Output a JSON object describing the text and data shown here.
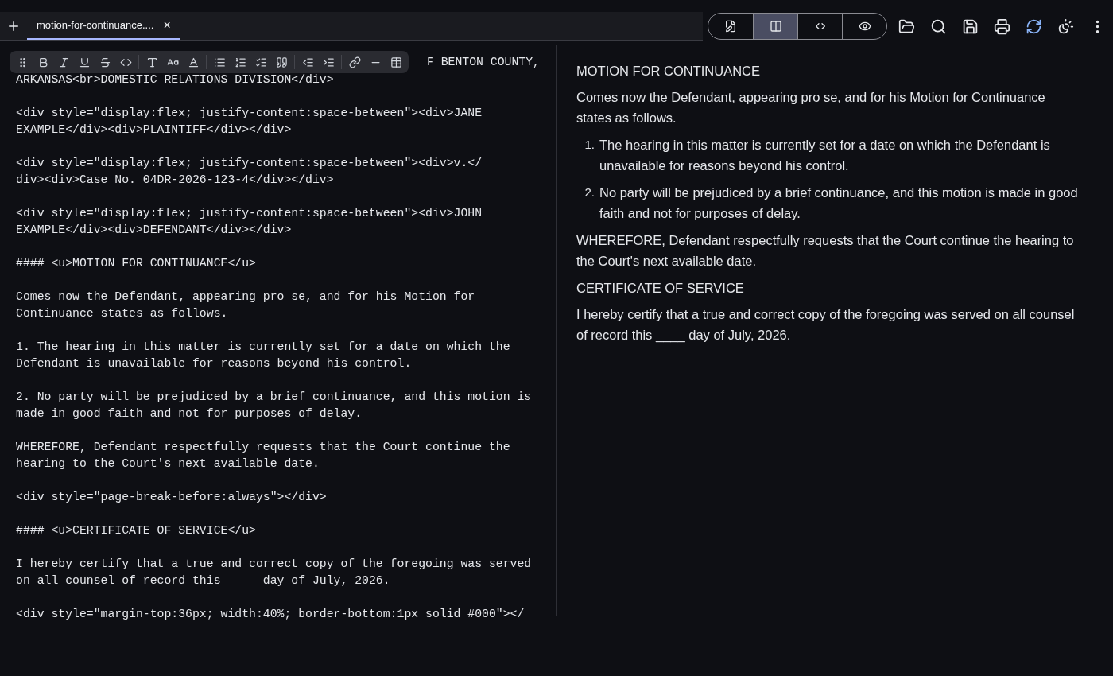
{
  "tabs": [
    {
      "label": "motion-for-continuance....",
      "selected": true,
      "close": "×"
    }
  ],
  "view_modes": [
    {
      "kind": "edit",
      "selected": false
    },
    {
      "kind": "split",
      "selected": true
    },
    {
      "kind": "source",
      "selected": false
    },
    {
      "kind": "preview",
      "selected": false
    }
  ],
  "editor": {
    "first_line_visible": "F BENTON COUNTY,",
    "blocks": [
      [
        "ARKANSAS<br>DOMESTIC RELATIONS DIVISION</div>"
      ],
      [
        "<div style=\"display:flex; justify-content:space-between\"><div>JANE",
        "EXAMPLE</div><div>PLAINTIFF</div></div>"
      ],
      [
        "<div style=\"display:flex; justify-content:space-between\"><div>v.</",
        "div><div>Case No. 04DR-2026-123-4</div></div>"
      ],
      [
        "<div style=\"display:flex; justify-content:space-between\"><div>JOHN",
        "EXAMPLE</div><div>DEFENDANT</div></div>"
      ],
      [
        "#### <u>MOTION FOR CONTINUANCE</u>"
      ],
      [
        "Comes now the Defendant, appearing pro se, and for his Motion for",
        "Continuance states as follows."
      ],
      [
        "1. The hearing in this matter is currently set for a date on which the",
        "Defendant is unavailable for reasons beyond his control."
      ],
      [
        "2. No party will be prejudiced by a brief continuance, and this motion is",
        "made in good faith and not for purposes of delay."
      ],
      [
        "WHEREFORE, Defendant respectfully requests that the Court continue the",
        "hearing to the Court's next available date."
      ],
      [
        "<div style=\"page-break-before:always\"></div>"
      ],
      [
        "#### <u>CERTIFICATE OF SERVICE</u>"
      ],
      [
        "I hereby certify that a true and correct copy of the foregoing was served",
        "on all counsel of record this ____ day of July, 2026."
      ],
      [
        "<div style=\"margin-top:36px; width:40%; border-bottom:1px solid #000\"></"
      ]
    ]
  },
  "preview": [
    {
      "kind": "heading",
      "text": "MOTION FOR CONTINUANCE"
    },
    {
      "kind": "paragraph",
      "text": "Comes now the Defendant, appearing pro se, and for his Motion for Continuance states as follows."
    },
    {
      "kind": "item",
      "marker": "1.",
      "text": "The hearing in this matter is currently set for a date on which the Defendant is unavailable for reasons beyond his control."
    },
    {
      "kind": "item",
      "marker": "2.",
      "text": "No party will be prejudiced by a brief continuance, and this motion is made in good faith and not for purposes of delay."
    },
    {
      "kind": "paragraph",
      "text": "WHEREFORE, Defendant respectfully requests that the Court continue the hearing to the Court's next available date."
    },
    {
      "kind": "heading",
      "text": "CERTIFICATE OF SERVICE"
    },
    {
      "kind": "paragraph",
      "text": "I hereby certify that a true and correct copy of the foregoing was served on all counsel of record this ____ day of July, 2026."
    }
  ]
}
